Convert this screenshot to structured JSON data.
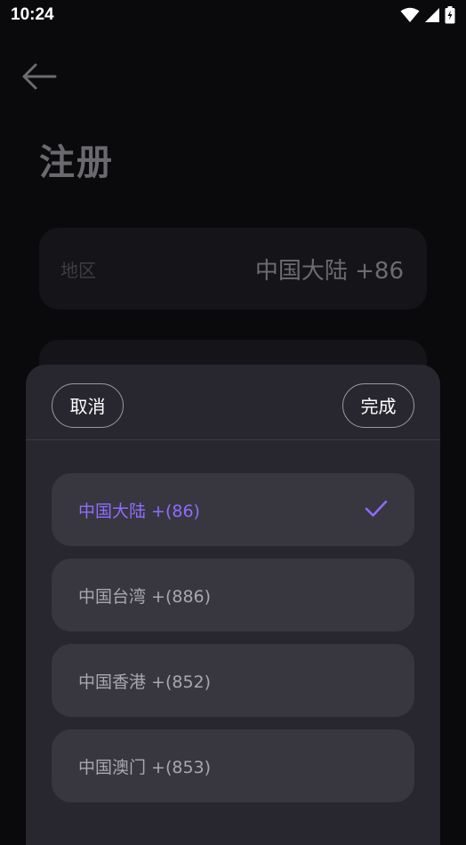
{
  "status_bar": {
    "time": "10:24",
    "icons": [
      "wifi-icon",
      "signal-icon",
      "battery-charging-icon"
    ]
  },
  "page": {
    "back_icon": "arrow-left-icon",
    "title": "注册",
    "region_field": {
      "label": "地区",
      "value": "中国大陆 +86"
    }
  },
  "sheet": {
    "cancel_label": "取消",
    "done_label": "完成",
    "options": [
      {
        "label": "中国大陆 +(86)",
        "selected": true
      },
      {
        "label": "中国台湾 +(886)",
        "selected": false
      },
      {
        "label": "中国香港 +(852)",
        "selected": false
      },
      {
        "label": "中国澳门 +(853)",
        "selected": false
      }
    ],
    "selected_icon": "check-icon"
  },
  "colors": {
    "background": "#0a0a0d",
    "sheet": "#28272f",
    "option": "#38373f",
    "accent": "#8f6cff"
  }
}
